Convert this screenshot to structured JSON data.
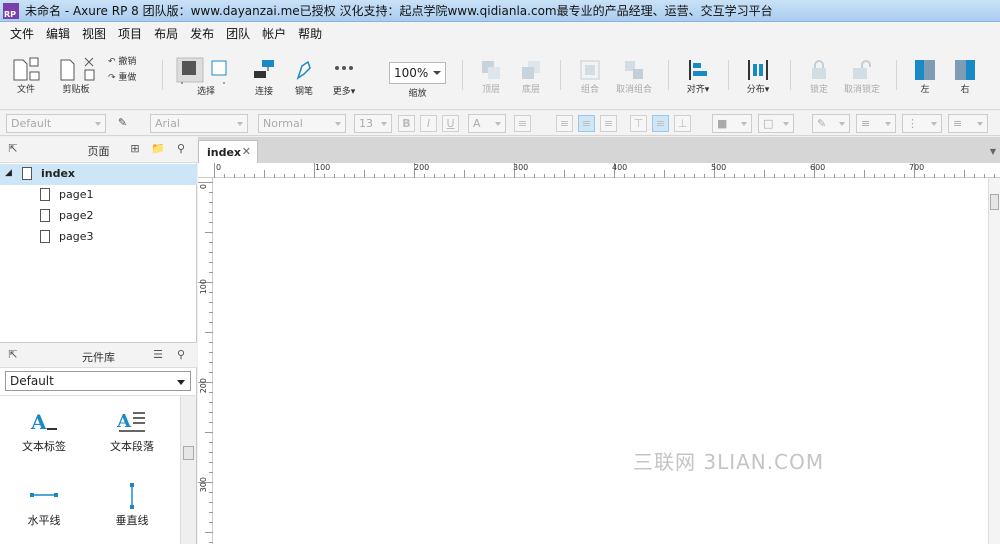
{
  "title": {
    "text": "未命名 - Axure RP 8 团队版：www.dayanzai.me已授权 汉化支持：起点学院www.qidianla.com最专业的产品经理、运营、交互学习平台",
    "icon": "RP"
  },
  "menu": [
    "文件",
    "编辑",
    "视图",
    "项目",
    "布局",
    "发布",
    "团队",
    "帐户",
    "帮助"
  ],
  "toolbar": {
    "file": "文件",
    "clipboard": "剪贴板",
    "undo": "撤销",
    "redo": "重做",
    "select": "选择",
    "connect": "连接",
    "pen": "钢笔",
    "more": "更多",
    "zoom_value": "100%",
    "zoom_label": "缩放",
    "top": "顶层",
    "bottom": "底层",
    "group": "组合",
    "ungroup": "取消组合",
    "align": "对齐",
    "distribute": "分布",
    "lock": "锁定",
    "unlock": "取消锁定",
    "left": "左",
    "right": "右"
  },
  "format": {
    "style": "Default",
    "font": "Arial",
    "weight": "Normal",
    "size": "13",
    "bold": "B",
    "italic": "I",
    "underline": "U",
    "text_color": "A"
  },
  "pages_panel": {
    "title": "页面",
    "items": [
      {
        "label": "index",
        "selected": true
      },
      {
        "label": "page1",
        "selected": false
      },
      {
        "label": "page2",
        "selected": false
      },
      {
        "label": "page3",
        "selected": false
      }
    ]
  },
  "library_panel": {
    "title": "元件库",
    "selected": "Default",
    "widgets": [
      "文本标签",
      "文本段落",
      "水平线",
      "垂直线"
    ]
  },
  "canvas": {
    "tab": "index",
    "ruler_h": [
      "0",
      "100",
      "200",
      "300",
      "400",
      "500",
      "600",
      "700"
    ],
    "ruler_v": [
      "0",
      "100",
      "200",
      "300"
    ]
  },
  "watermark": "三联网 3LIAN.COM",
  "colors": {
    "accent": "#1a8ac6",
    "selection": "#cde6f7",
    "titlebar": "#b7d6f2"
  }
}
